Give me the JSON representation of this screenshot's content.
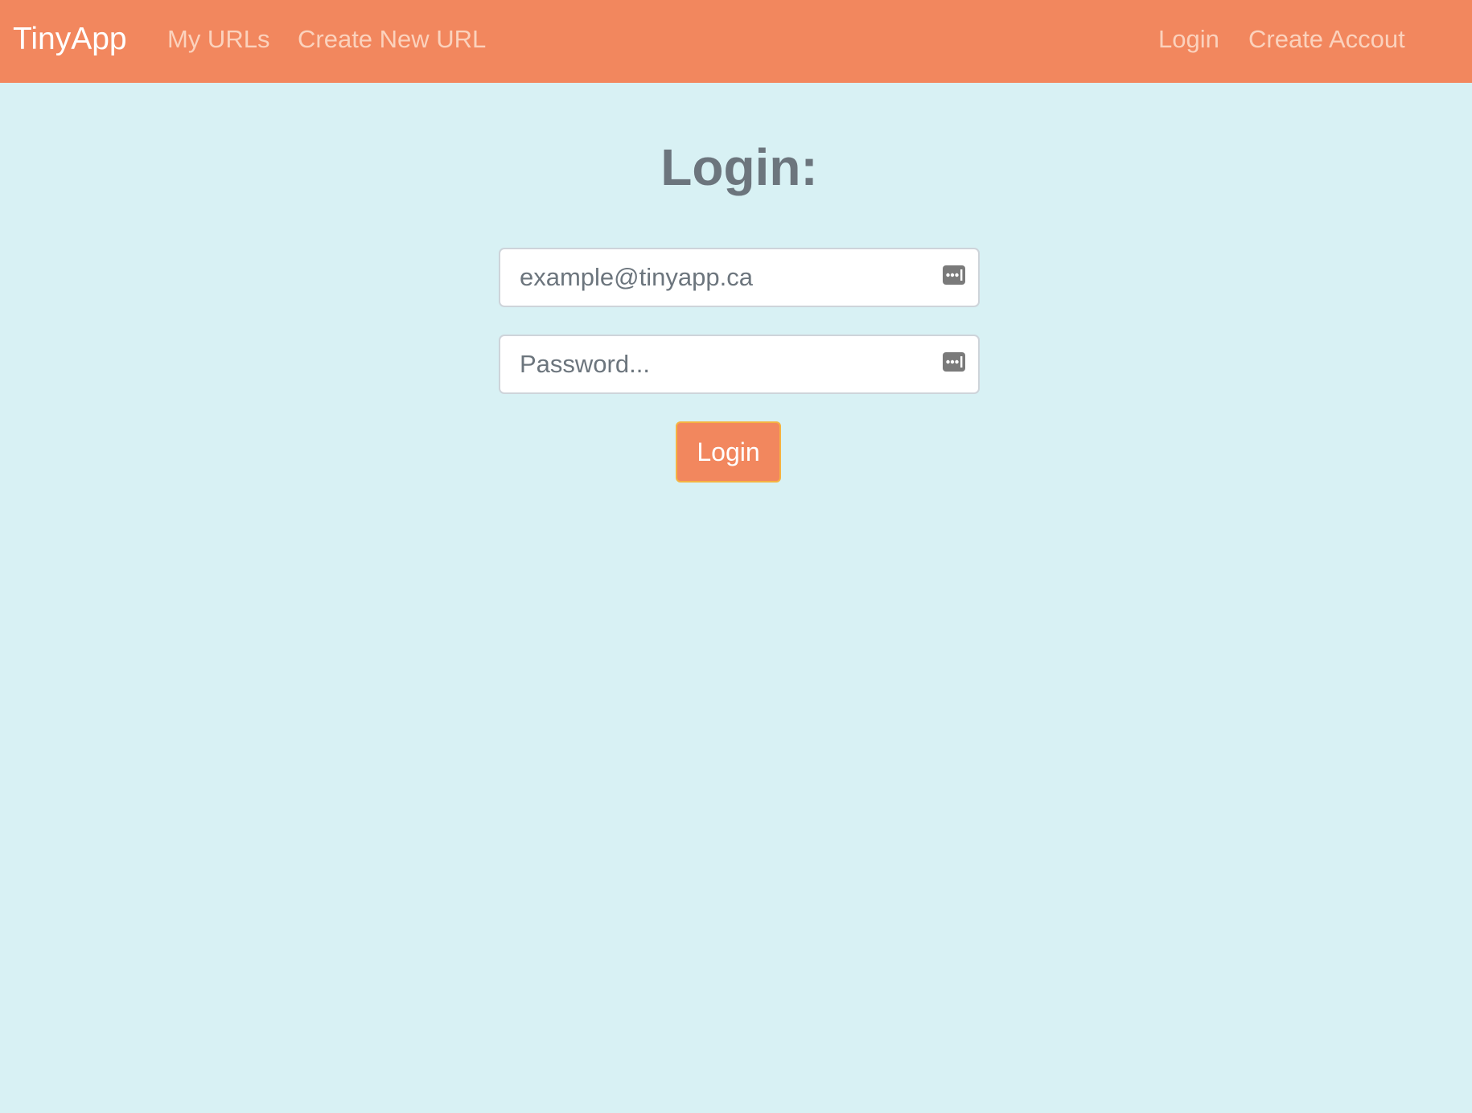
{
  "navbar": {
    "brand": "TinyApp",
    "links": [
      {
        "label": "My URLs"
      },
      {
        "label": "Create New URL"
      }
    ],
    "right_links": [
      {
        "label": "Login"
      },
      {
        "label": "Create Accout"
      }
    ],
    "background_color": "#f2875e"
  },
  "main": {
    "title": "Login:",
    "email": {
      "value": "example@tinyapp.ca",
      "autofill_icon": "password-manager-icon"
    },
    "password": {
      "placeholder": "Password...",
      "value": "",
      "autofill_icon": "password-manager-icon"
    },
    "submit_label": "Login",
    "background_color": "#d8f1f4"
  }
}
